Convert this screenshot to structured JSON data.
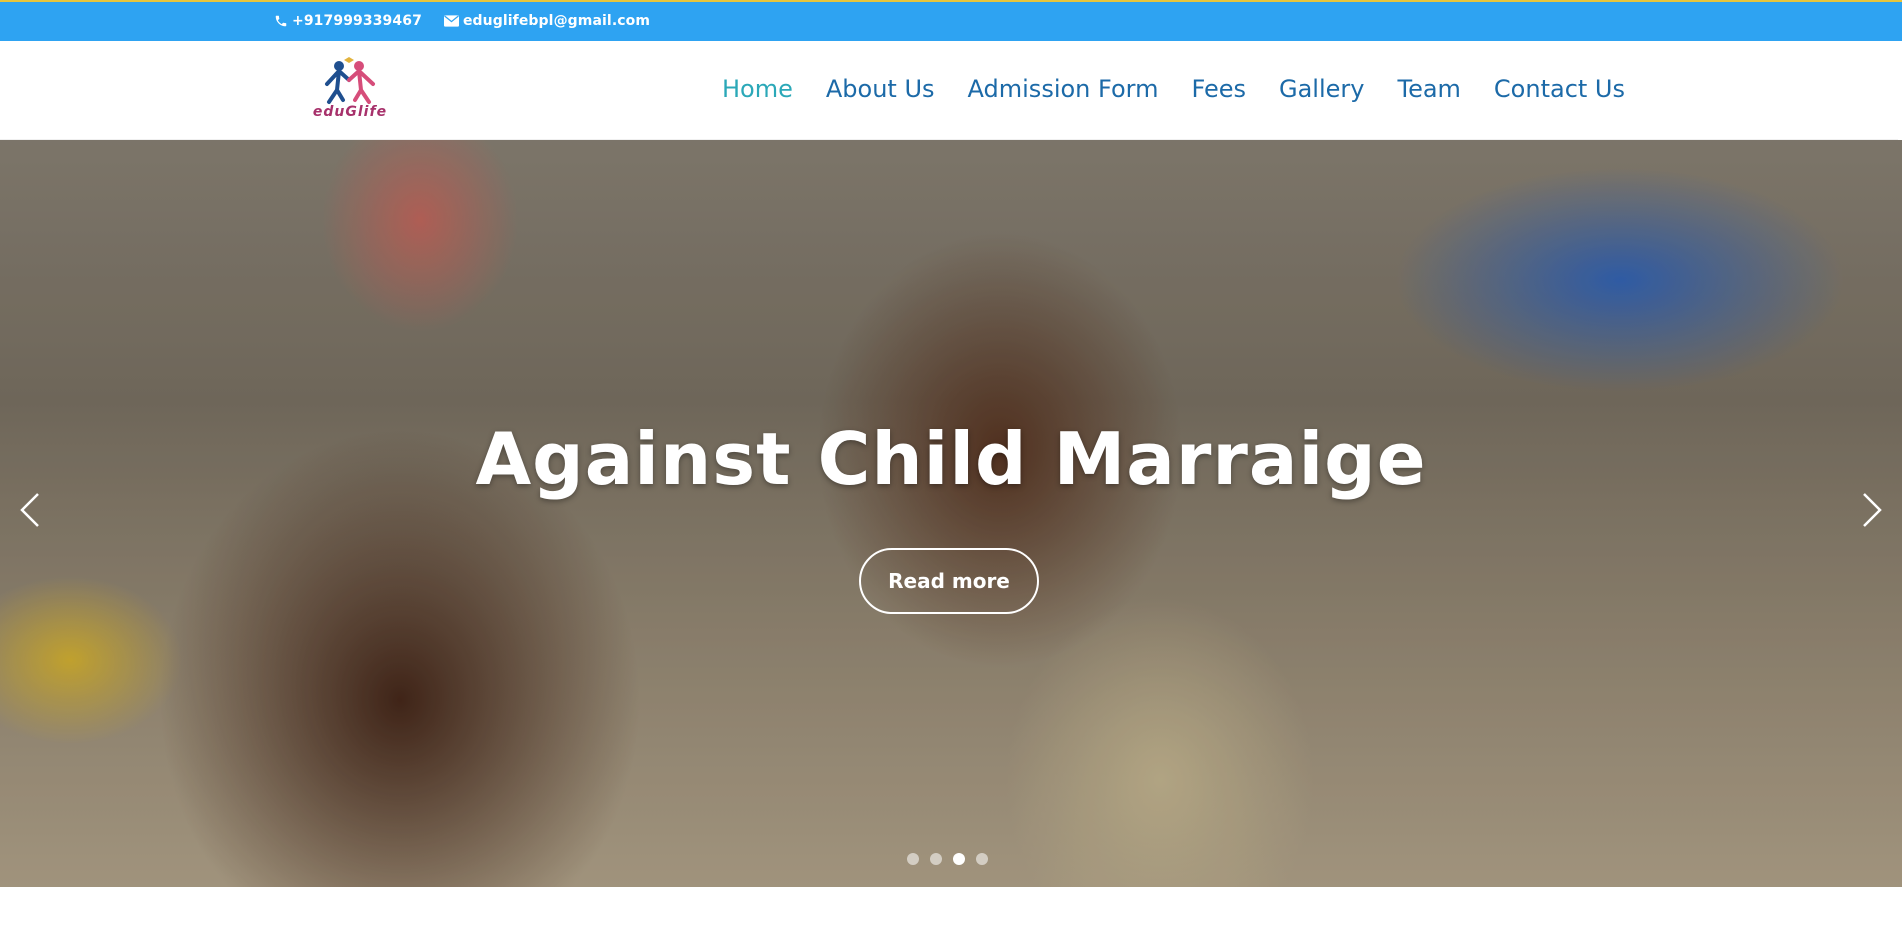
{
  "topbar": {
    "phone": "+917999339467",
    "email": "eduglifebpl@gmail.com",
    "colors": {
      "background": "#2ea3f2",
      "border": "#e6c53d"
    }
  },
  "header": {
    "logo_text": "eduGlife",
    "nav": [
      {
        "label": "Home",
        "active": true
      },
      {
        "label": "About Us",
        "active": false
      },
      {
        "label": "Admission Form",
        "active": false
      },
      {
        "label": "Fees",
        "active": false
      },
      {
        "label": "Gallery",
        "active": false
      },
      {
        "label": "Team",
        "active": false
      },
      {
        "label": "Contact Us",
        "active": false
      }
    ],
    "colors": {
      "nav_link": "#1c6aa8",
      "nav_active": "#2ba8b8"
    }
  },
  "hero": {
    "title": "Against Child Marraige",
    "button_label": "Read more",
    "slides_count": 4,
    "active_slide": 3
  }
}
